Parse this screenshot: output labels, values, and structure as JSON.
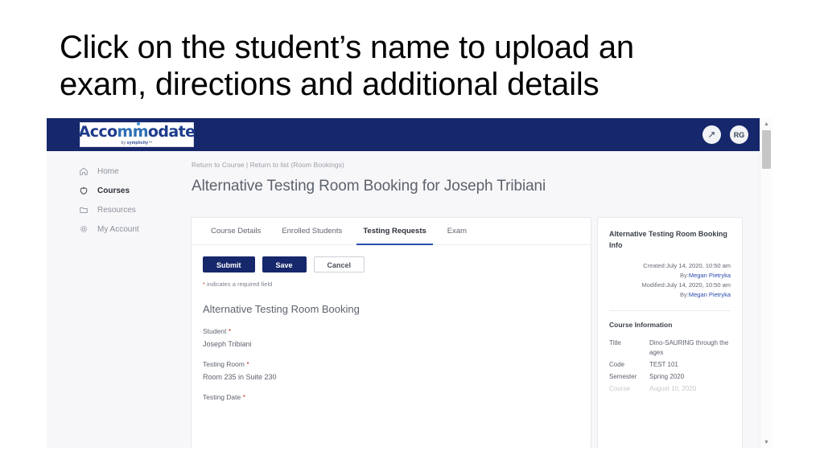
{
  "slide": {
    "heading": "Click on the student’s name to upload an exam, directions and additional details"
  },
  "colors": {
    "brand_navy": "#16276b",
    "accent_blue": "#2a4bad",
    "required_red": "#c0392b",
    "page_bg": "#f7f7f9"
  },
  "topbar": {
    "logo_word_start": "Acco",
    "logo_word_accent": "mm",
    "logo_word_end": "odate",
    "logo_sub_prefix": "by ",
    "logo_sub_brand": "symplicity",
    "logo_sub_suffix": "™",
    "help_icon": "expand-arrow-icon",
    "avatar_initials": "RG"
  },
  "sidebar": {
    "items": [
      {
        "label": "Home",
        "icon": "home-icon",
        "active": false
      },
      {
        "label": "Courses",
        "icon": "apple-icon",
        "active": true
      },
      {
        "label": "Resources",
        "icon": "folder-icon",
        "active": false
      },
      {
        "label": "My Account",
        "icon": "gear-icon",
        "active": false
      }
    ]
  },
  "content": {
    "breadcrumb": "Return to Course | Return to list (Room Bookings)",
    "page_title": "Alternative Testing Room Booking for Joseph Tribiani"
  },
  "tabs": [
    {
      "label": "Course Details",
      "active": false
    },
    {
      "label": "Enrolled Students",
      "active": false
    },
    {
      "label": "Testing Requests",
      "active": true
    },
    {
      "label": "Exam",
      "active": false
    }
  ],
  "actions": {
    "submit_label": "Submit",
    "save_label": "Save",
    "cancel_label": "Cancel",
    "required_star": "*",
    "required_note": " indicates a required field"
  },
  "form": {
    "section_title": "Alternative Testing Room Booking",
    "fields": [
      {
        "label": "Student",
        "required": true,
        "value": "Joseph Tribiani"
      },
      {
        "label": "Testing Room",
        "required": true,
        "value": "Room 235 in Suite 230"
      },
      {
        "label": "Testing Date",
        "required": true,
        "value": ""
      }
    ]
  },
  "info_panel": {
    "title": "Alternative Testing Room Booking Info",
    "meta": [
      {
        "key": "Created:",
        "value": "July 14, 2020, 10:50 am",
        "link": false
      },
      {
        "key": "By:",
        "value": "Megan Pietryka",
        "link": true
      },
      {
        "key": "Modified:",
        "value": "July 14, 2020, 10:50 am",
        "link": false
      },
      {
        "key": "By:",
        "value": "Megan Pietryka",
        "link": true
      }
    ],
    "course_section_title": "Course Information",
    "course_rows": [
      {
        "key": "Title",
        "value": "Dino-SAURING through the ages",
        "cut_off": false
      },
      {
        "key": "Code",
        "value": "TEST 101",
        "cut_off": false
      },
      {
        "key": "Semester",
        "value": "Spring 2020",
        "cut_off": false
      },
      {
        "key": "Course",
        "value": "August 10, 2020",
        "cut_off": true
      }
    ]
  },
  "scrollbar": {
    "up_arrow": "▲",
    "down_arrow": "▼"
  }
}
